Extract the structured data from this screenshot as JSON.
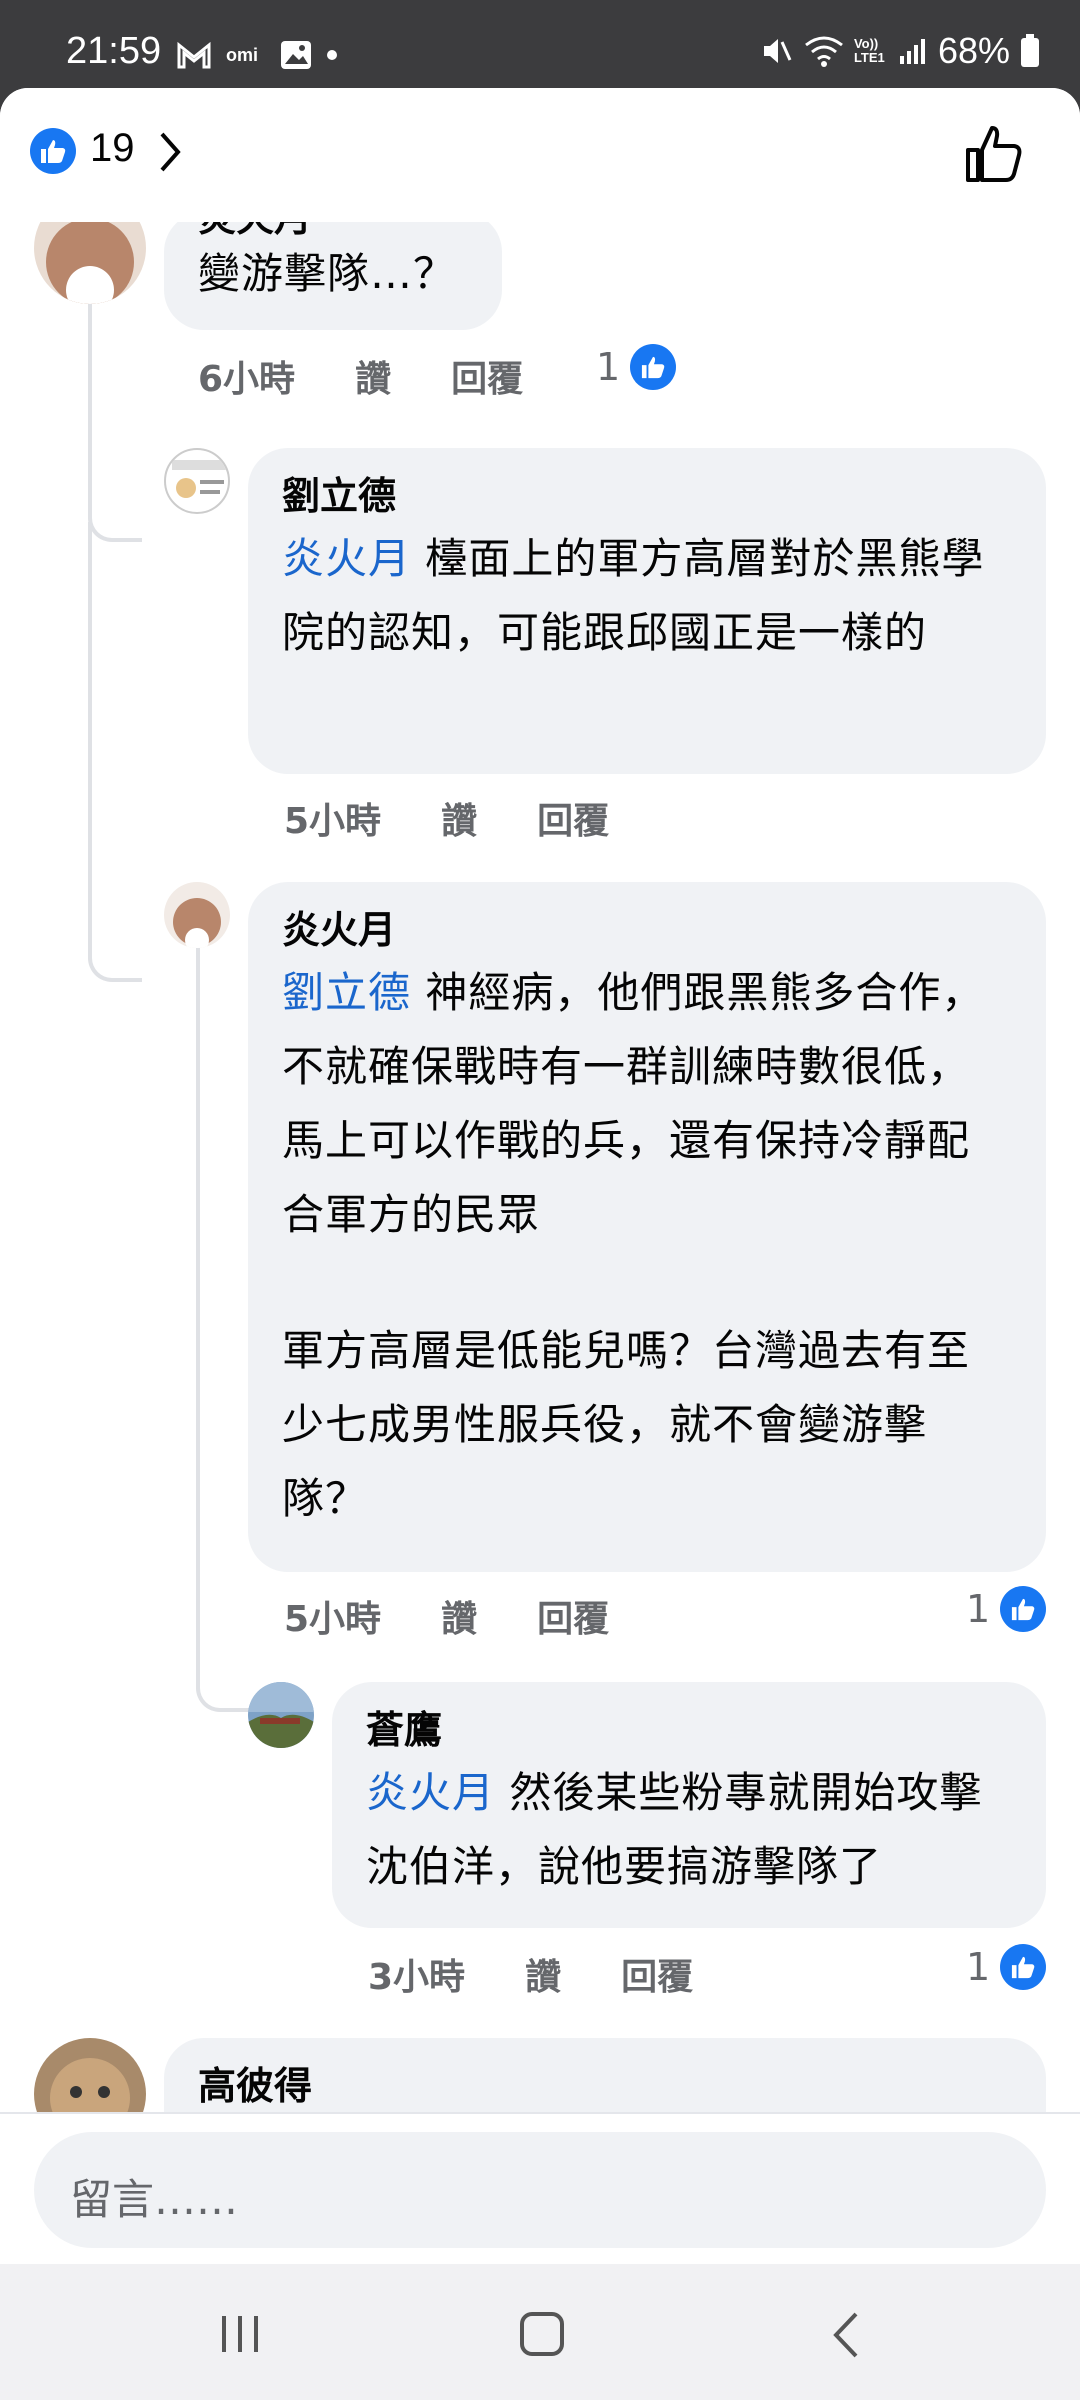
{
  "status": {
    "time": "21:59",
    "battery": "68%",
    "net_small": "Vo)) LTE1"
  },
  "header": {
    "like_count": "19"
  },
  "comments": [
    {
      "author": "炎火月",
      "text": "變游擊隊…？",
      "time": "6小時",
      "like": "讚",
      "reply": "回覆",
      "reactions": "1"
    },
    {
      "author": "劉立德",
      "mention": "炎火月",
      "text": " 檯面上的軍方高層對於黑熊學院的認知，可能跟邱國正是一樣的",
      "time": "5小時",
      "like": "讚",
      "reply": "回覆"
    },
    {
      "author": "炎火月",
      "mention": "劉立德",
      "text": " 神經病，他們跟黑熊多合作，不就確保戰時有一群訓練時數很低，馬上可以作戰的兵，還有保持冷靜配合軍方的民眾",
      "text2": "軍方高層是低能兒嗎？台灣過去有至少七成男性服兵役，就不會變游擊隊？",
      "time": "5小時",
      "like": "讚",
      "reply": "回覆",
      "reactions": "1"
    },
    {
      "author": "蒼鷹",
      "mention": "炎火月",
      "text": " 然後某些粉專就開始攻擊沈伯洋，說他要搞游擊隊了",
      "time": "3小時",
      "like": "讚",
      "reply": "回覆",
      "reactions": "1"
    },
    {
      "author": "高彼得"
    }
  ],
  "input": {
    "placeholder": "留言……"
  }
}
